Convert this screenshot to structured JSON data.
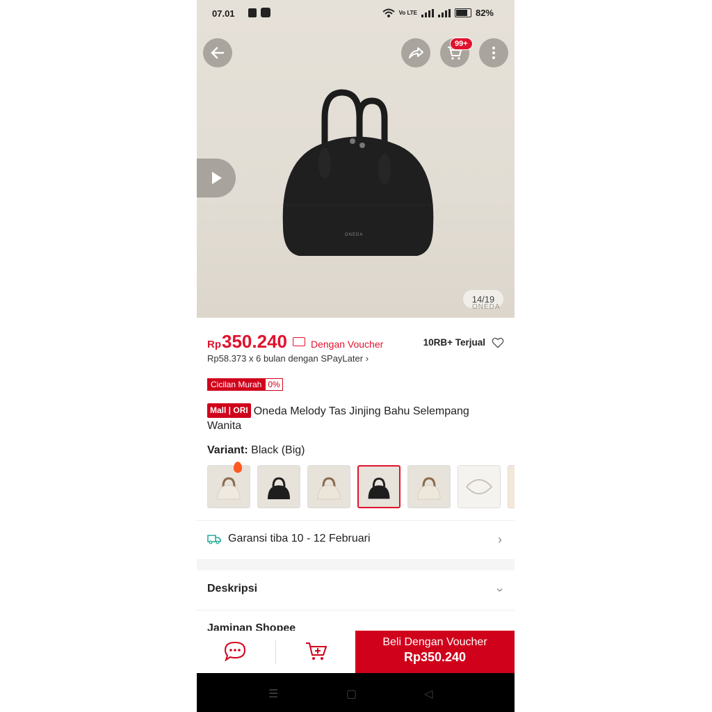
{
  "status_bar": {
    "time": "07.01",
    "network": "Vo LTE",
    "battery": "82%"
  },
  "hero": {
    "image_counter": "14/19",
    "cart_badge": "99+",
    "brand_watermark": "ONEDA",
    "bag_logo": "ONEDA"
  },
  "product": {
    "price_currency": "Rp",
    "price_value": "350.240",
    "voucher_label": "Dengan Voucher",
    "sold": "10RB+ Terjual",
    "paylater": "Rp58.373 x 6 bulan dengan SPayLater",
    "cicilan_label": "Cicilan Murah",
    "cicilan_rate": "0%",
    "mall_badge": "Mall | ORI",
    "title": "Oneda Melody Tas Jinjing Bahu Selempang Wanita",
    "variant_label": "Variant:",
    "variant_value": "Black (Big)"
  },
  "variants": [
    {
      "color": "#efe9df"
    },
    {
      "color": "#1e1e1e"
    },
    {
      "color": "#ebe5da"
    },
    {
      "color": "#1e1e1e"
    },
    {
      "color": "#eee7db"
    },
    {
      "color": "#f5f3f0"
    }
  ],
  "shipping": {
    "text": "Garansi tiba 10 - 12 Februari"
  },
  "sections": {
    "description": "Deskripsi",
    "guarantee": "Jaminan Shopee"
  },
  "bottom_bar": {
    "buy_label": "Beli Dengan Voucher",
    "buy_price": "Rp350.240"
  },
  "colors": {
    "accent": "#e0122d",
    "buy_bg": "#d0011b"
  }
}
